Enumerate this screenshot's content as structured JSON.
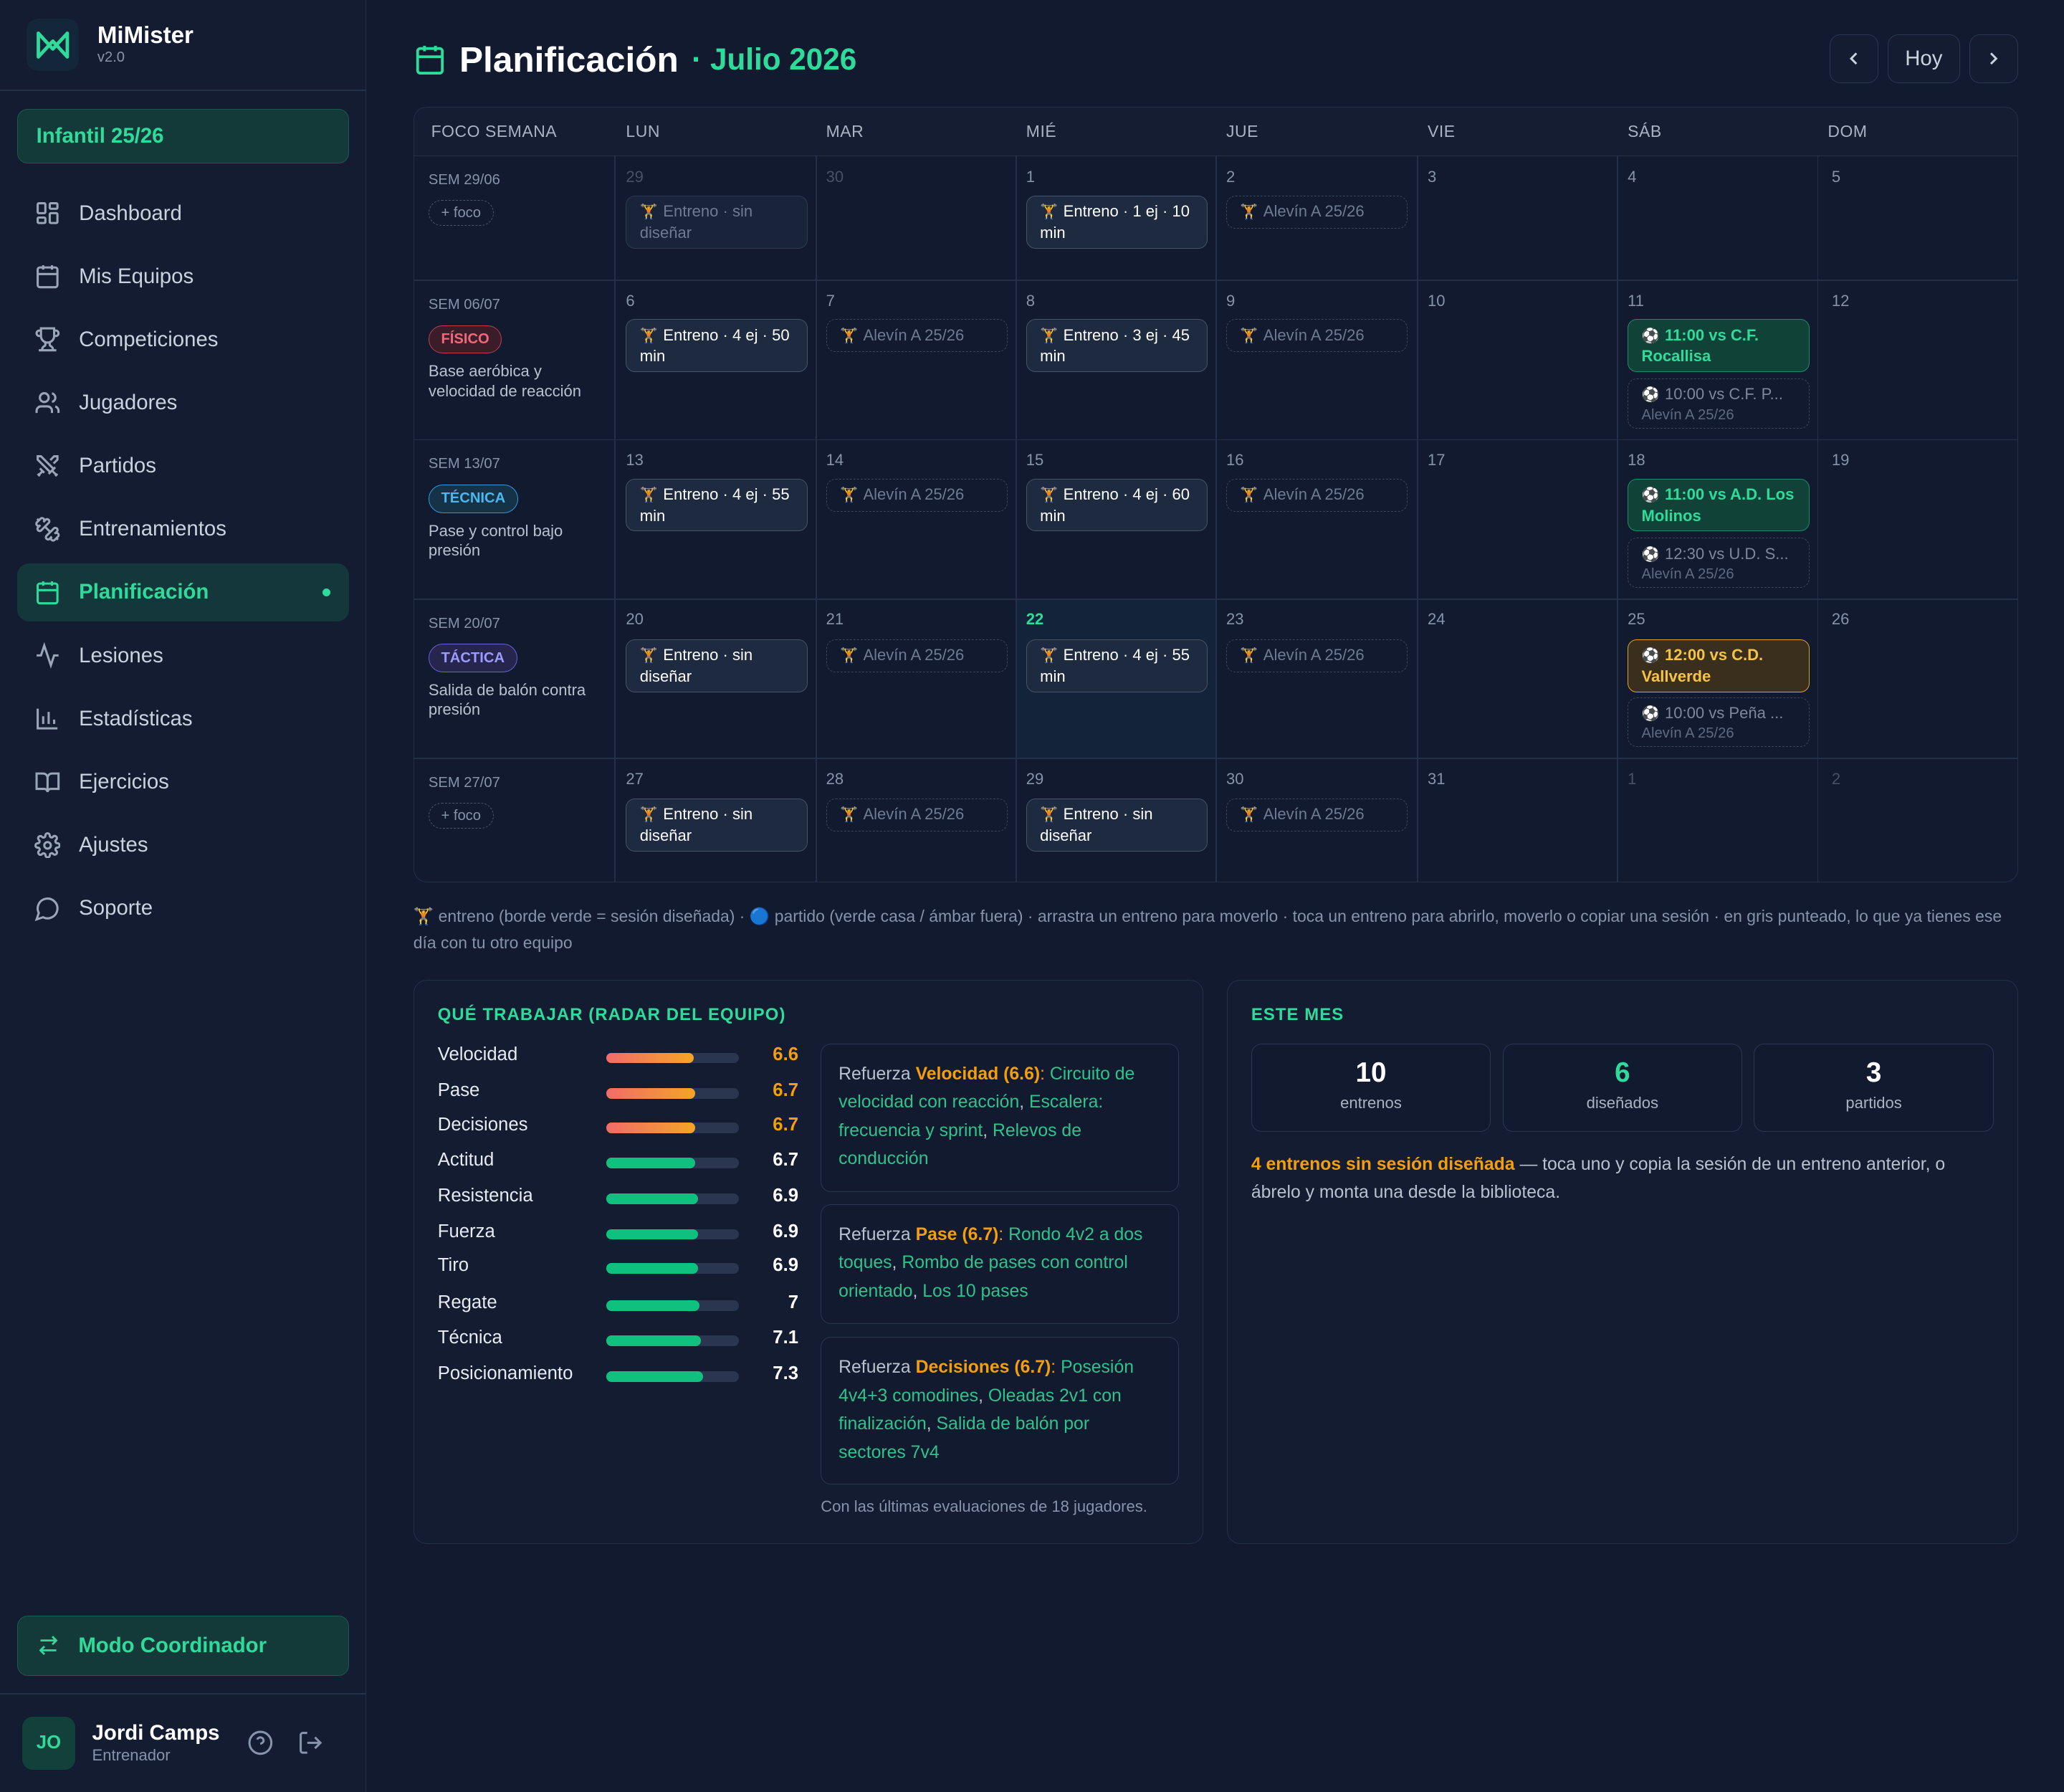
{
  "app": {
    "name": "MiMister",
    "version": "v2.0"
  },
  "team_selector": {
    "label": "Infantil 25/26"
  },
  "nav": [
    {
      "label": "Dashboard",
      "icon": "dashboard-icon"
    },
    {
      "label": "Mis Equipos",
      "icon": "calendar-icon"
    },
    {
      "label": "Competiciones",
      "icon": "trophy-icon"
    },
    {
      "label": "Jugadores",
      "icon": "users-icon"
    },
    {
      "label": "Partidos",
      "icon": "swords-icon"
    },
    {
      "label": "Entrenamientos",
      "icon": "dumbbell-icon"
    },
    {
      "label": "Planificación",
      "icon": "calendar-icon",
      "active": true
    },
    {
      "label": "Lesiones",
      "icon": "pulse-icon"
    },
    {
      "label": "Estadísticas",
      "icon": "bar-chart-icon"
    },
    {
      "label": "Ejercicios",
      "icon": "book-icon"
    },
    {
      "label": "Ajustes",
      "icon": "gear-icon"
    },
    {
      "label": "Soporte",
      "icon": "chat-icon"
    }
  ],
  "coordinator_button": {
    "label": "Modo Coordinador"
  },
  "user": {
    "initials": "JO",
    "name": "Jordi Camps",
    "role": "Entrenador"
  },
  "header": {
    "title": "Planificación",
    "subtitle": "· Julio 2026",
    "today_button": "Hoy"
  },
  "calendar": {
    "columns": [
      "FOCO SEMANA",
      "LUN",
      "MAR",
      "MIÉ",
      "JUE",
      "VIE",
      "SÁB",
      "DOM"
    ],
    "weeks": [
      {
        "label": "SEM 29/06",
        "add_focus": "+ foco",
        "days": [
          "29",
          "30",
          "1",
          "2",
          "3",
          "4",
          "5"
        ]
      },
      {
        "label": "SEM 06/07",
        "tag": "FÍSICO",
        "desc": "Base aeróbica y velocidad de reacción",
        "days": [
          "6",
          "7",
          "8",
          "9",
          "10",
          "11",
          "12"
        ]
      },
      {
        "label": "SEM 13/07",
        "tag": "TÉCNICA",
        "desc": "Pase y control bajo presión",
        "days": [
          "13",
          "14",
          "15",
          "16",
          "17",
          "18",
          "19"
        ]
      },
      {
        "label": "SEM 20/07",
        "tag": "TÁCTICA",
        "desc": "Salida de balón contra presión",
        "days": [
          "20",
          "21",
          "22",
          "23",
          "24",
          "25",
          "26"
        ]
      },
      {
        "label": "SEM 27/07",
        "add_focus": "+ foco",
        "days": [
          "27",
          "28",
          "29",
          "30",
          "31",
          "1",
          "2"
        ]
      }
    ],
    "events": {
      "w0_mon": "Entreno · sin diseñar",
      "w0_wed": "Entreno · 1 ej · 10 min",
      "w0_thu": "Alevín A 25/26",
      "w1_mon": "Entreno · 4 ej · 50 min",
      "w1_tue": "Alevín A 25/26",
      "w1_wed": "Entreno · 3 ej · 45 min",
      "w1_thu": "Alevín A 25/26",
      "w1_sat_match": "11:00 vs C.F. Rocallisa",
      "w1_sat_other": "10:00 vs C.F. P...",
      "w1_sat_other_team": "Alevín A 25/26",
      "w2_mon": "Entreno · 4 ej · 55 min",
      "w2_tue": "Alevín A 25/26",
      "w2_wed": "Entreno · 4 ej · 60 min",
      "w2_thu": "Alevín A 25/26",
      "w2_sat_match": "11:00 vs A.D. Los Molinos",
      "w2_sat_other": "12:30 vs U.D. S...",
      "w2_sat_other_team": "Alevín A 25/26",
      "w3_mon": "Entreno · sin diseñar",
      "w3_tue": "Alevín A 25/26",
      "w3_wed": "Entreno · 4 ej · 55 min",
      "w3_thu": "Alevín A 25/26",
      "w3_sat_match": "12:00 vs C.D. Vallverde",
      "w3_sat_other": "10:00 vs Peña ...",
      "w3_sat_other_team": "Alevín A 25/26",
      "w4_mon": "Entreno · sin diseñar",
      "w4_tue": "Alevín A 25/26",
      "w4_wed": "Entreno · sin diseñar",
      "w4_thu": "Alevín A 25/26"
    },
    "legend": "entreno (borde verde = sesión diseñada) · 🔵 partido (verde casa / ámbar fuera) · arrastra un entreno para moverlo · toca un entreno para abrirlo, moverlo o copiar una sesión · en gris punteado, lo que ya tienes ese día con tu otro equipo"
  },
  "radar": {
    "title": "QUÉ TRABAJAR (RADAR DEL EQUIPO)",
    "scale_max": 10,
    "rows": [
      {
        "name": "Velocidad",
        "value": 6.6,
        "label": "6.6",
        "weak": true
      },
      {
        "name": "Pase",
        "value": 6.7,
        "label": "6.7",
        "weak": true
      },
      {
        "name": "Decisiones",
        "value": 6.7,
        "label": "6.7",
        "weak": true
      },
      {
        "name": "Actitud",
        "value": 6.7,
        "label": "6.7"
      },
      {
        "name": "Resistencia",
        "value": 6.9,
        "label": "6.9"
      },
      {
        "name": "Fuerza",
        "value": 6.9,
        "label": "6.9"
      },
      {
        "name": "Tiro",
        "value": 6.9,
        "label": "6.9"
      },
      {
        "name": "Regate",
        "value": 7,
        "label": "7"
      },
      {
        "name": "Técnica",
        "value": 7.1,
        "label": "7.1"
      },
      {
        "name": "Posicionamiento",
        "value": 7.3,
        "label": "7.3"
      }
    ],
    "recommendations": [
      {
        "prefix": "Refuerza ",
        "skill": "Velocidad (6.6)",
        "colon": ": ",
        "exercises": [
          "Circuito de velocidad con reacción",
          "Escalera: frecuencia y sprint",
          "Relevos de conducción"
        ]
      },
      {
        "prefix": "Refuerza ",
        "skill": "Pase (6.7)",
        "colon": ": ",
        "exercises": [
          "Rondo 4v2 a dos toques",
          "Rombo de pases con control orientado",
          "Los 10 pases"
        ]
      },
      {
        "prefix": "Refuerza ",
        "skill": "Decisiones (6.7)",
        "colon": ": ",
        "exercises": [
          "Posesión 4v4+3 comodines",
          "Oleadas 2v1 con finalización",
          "Salida de balón por sectores 7v4"
        ]
      }
    ],
    "footnote": "Con las últimas evaluaciones de 18 jugadores."
  },
  "month": {
    "title": "ESTE MES",
    "stats": [
      {
        "value": "10",
        "label": "entrenos"
      },
      {
        "value": "6",
        "label": "diseñados"
      },
      {
        "value": "3",
        "label": "partidos"
      }
    ],
    "warning": "4 entrenos sin sesión diseñada",
    "note": " — toca uno y copia la sesión de un entreno anterior, o ábrelo y monta una desde la biblioteca."
  },
  "colors": {
    "accent": "#2fdb9a",
    "warning": "#f59e0b",
    "background": "#111a2e"
  }
}
